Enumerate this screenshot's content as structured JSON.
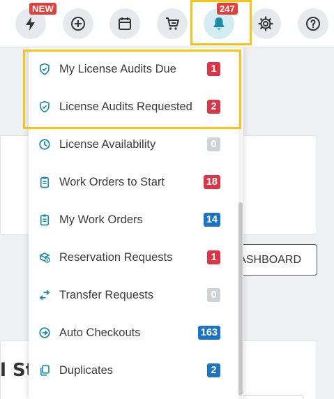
{
  "topbar": {
    "new_badge": "NEW",
    "notification_count": "247",
    "buttons": [
      {
        "icon": "lightning-bolt-icon"
      },
      {
        "icon": "plus-circle-icon"
      },
      {
        "icon": "calendar-icon"
      },
      {
        "icon": "shopping-cart-icon"
      },
      {
        "icon": "bell-icon"
      },
      {
        "icon": "gear-icon"
      },
      {
        "icon": "help-circle-icon"
      }
    ]
  },
  "background": {
    "dashboard_button": "ASHBOARD",
    "card_title": "l St"
  },
  "notifications": {
    "items": [
      {
        "label": "My License Audits Due",
        "count": "1",
        "icon": "shield-check-icon",
        "badge_color": "#dc3545"
      },
      {
        "label": "License Audits Requested",
        "count": "2",
        "icon": "shield-check-icon",
        "badge_color": "#dc3545"
      },
      {
        "label": "License Availability",
        "count": "0",
        "icon": "clock-icon",
        "badge_color": "#cfd2d6"
      },
      {
        "label": "Work Orders to Start",
        "count": "18",
        "icon": "clipboard-icon",
        "badge_color": "#dc3545"
      },
      {
        "label": "My Work Orders",
        "count": "14",
        "icon": "clipboard-icon",
        "badge_color": "#1a73c9"
      },
      {
        "label": "Reservation Requests",
        "count": "1",
        "icon": "reservation-icon",
        "badge_color": "#dc3545"
      },
      {
        "label": "Transfer Requests",
        "count": "0",
        "icon": "transfer-arrows-icon",
        "badge_color": "#cfd2d6"
      },
      {
        "label": "Auto Checkouts",
        "count": "163",
        "icon": "arrow-circle-right-icon",
        "badge_color": "#1a73c9"
      },
      {
        "label": "Duplicates",
        "count": "2",
        "icon": "duplicate-icon",
        "badge_color": "#1a73c9"
      }
    ]
  },
  "colors": {
    "accent": "#1a8aa8",
    "highlight": "#f5c518",
    "danger": "#dc3545",
    "info": "#1a73c9",
    "neutral": "#cfd2d6"
  }
}
